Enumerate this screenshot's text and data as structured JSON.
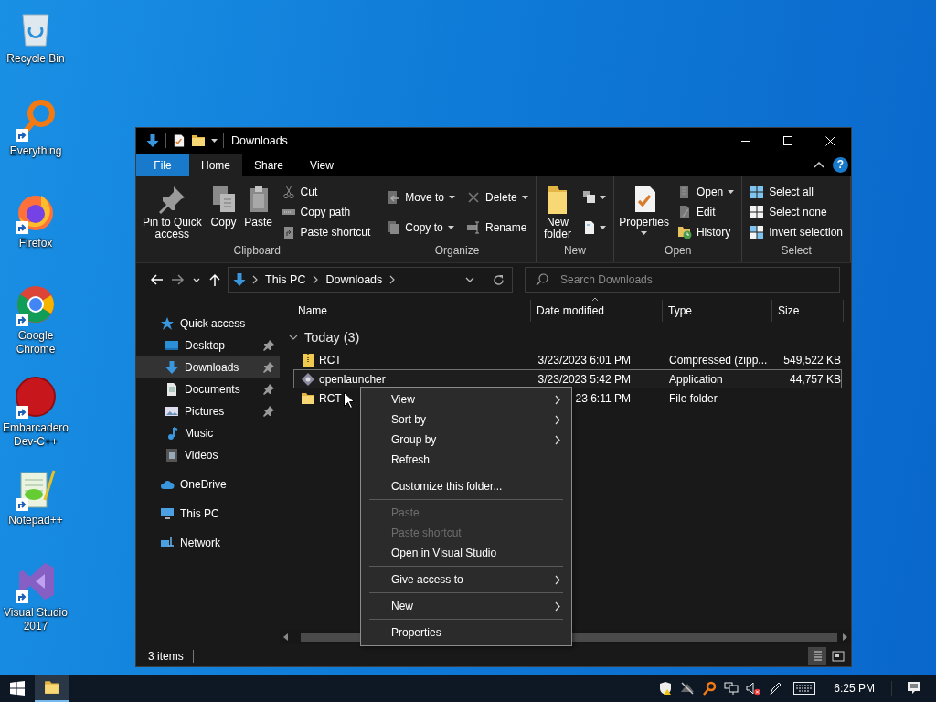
{
  "desktop_icons": [
    {
      "label": "Recycle Bin",
      "shortcut": false
    },
    {
      "label": "Everything",
      "shortcut": true
    },
    {
      "label": "Firefox",
      "shortcut": true
    },
    {
      "label": "Google Chrome",
      "shortcut": true
    },
    {
      "label": "Embarcadero Dev-C++",
      "shortcut": true
    },
    {
      "label": "Notepad++",
      "shortcut": true
    },
    {
      "label": "Visual Studio 2017",
      "shortcut": true
    }
  ],
  "window": {
    "title": "Downloads",
    "tabs": [
      {
        "label": "File",
        "kind": "file",
        "selected": false
      },
      {
        "label": "Home",
        "kind": "tab",
        "selected": true
      },
      {
        "label": "Share",
        "kind": "tab",
        "selected": false
      },
      {
        "label": "View",
        "kind": "tab",
        "selected": false
      }
    ],
    "help": "?",
    "ribbon": [
      {
        "label": "Clipboard",
        "items": [
          {
            "kind": "large",
            "label": "Pin to Quick access",
            "dropdown": false
          },
          {
            "kind": "large",
            "label": "Copy",
            "dropdown": false
          },
          {
            "kind": "large",
            "label": "Paste",
            "dropdown": false
          },
          {
            "kind": "stack",
            "items": [
              {
                "label": "Cut",
                "dropdown": false
              },
              {
                "label": "Copy path",
                "dropdown": false
              },
              {
                "label": "Paste shortcut",
                "dropdown": false
              }
            ]
          }
        ]
      },
      {
        "label": "Organize",
        "items": [
          {
            "kind": "stack",
            "items": [
              {
                "label": "Move to",
                "dropdown": true
              },
              {
                "label": "Copy to",
                "dropdown": true
              }
            ]
          },
          {
            "kind": "stack",
            "items": [
              {
                "label": "Delete",
                "dropdown": true
              },
              {
                "label": "Rename",
                "dropdown": false
              }
            ]
          }
        ]
      },
      {
        "label": "New",
        "items": [
          {
            "kind": "large",
            "label": "New folder",
            "dropdown": false
          },
          {
            "kind": "stack",
            "items": [
              {
                "dropdown": true
              },
              {
                "dropdown": true
              }
            ]
          }
        ]
      },
      {
        "label": "Open",
        "items": [
          {
            "kind": "large",
            "label": "Properties",
            "dropdown": true
          },
          {
            "kind": "stack",
            "items": [
              {
                "label": "Open",
                "dropdown": true
              },
              {
                "label": "Edit",
                "dropdown": false
              },
              {
                "label": "History",
                "dropdown": false
              }
            ]
          }
        ]
      },
      {
        "label": "Select",
        "items": [
          {
            "kind": "stack",
            "items": [
              {
                "label": "Select all",
                "dropdown": false
              },
              {
                "label": "Select none",
                "dropdown": false
              },
              {
                "label": "Invert selection",
                "dropdown": false
              }
            ]
          }
        ]
      }
    ],
    "address": {
      "path": [
        "This PC",
        "Downloads"
      ]
    },
    "search": {
      "placeholder": "Search Downloads"
    },
    "nav": [
      {
        "label": "Quick access",
        "selected": false,
        "children": [
          {
            "label": "Desktop",
            "selected": false,
            "pinned": true
          },
          {
            "label": "Downloads",
            "selected": true,
            "pinned": true
          },
          {
            "label": "Documents",
            "selected": false,
            "pinned": true
          },
          {
            "label": "Pictures",
            "selected": false,
            "pinned": true
          },
          {
            "label": "Music",
            "selected": false,
            "pinned": false
          },
          {
            "label": "Videos",
            "selected": false,
            "pinned": false
          }
        ]
      },
      {
        "label": "OneDrive",
        "selected": false
      },
      {
        "label": "This PC",
        "selected": false
      },
      {
        "label": "Network",
        "selected": false
      }
    ],
    "columns": [
      {
        "label": "Name",
        "sorted": false
      },
      {
        "label": "Date modified",
        "sorted": true
      },
      {
        "label": "Type",
        "sorted": false
      },
      {
        "label": "Size",
        "sorted": false
      }
    ],
    "groups": [
      {
        "label": "Today (3)",
        "expanded": true,
        "rows": [
          {
            "kind": "zip",
            "name": "RCT",
            "date": "3/23/2023 6:01 PM",
            "type": "Compressed (zipp...",
            "size": "549,522 KB",
            "selected": false
          },
          {
            "kind": "app",
            "name": "openlauncher",
            "date": "3/23/2023 5:42 PM",
            "type": "Application",
            "size": "44,757 KB",
            "selected": true
          },
          {
            "kind": "folder",
            "name": "RCT",
            "date": "23 6:11 PM",
            "type": "File folder",
            "selected": false
          }
        ]
      }
    ],
    "status": {
      "text": "3 items",
      "views": [
        {
          "kind": "details",
          "selected": true
        },
        {
          "kind": "tiles",
          "selected": false
        }
      ]
    }
  },
  "context_menu": [
    {
      "kind": "item",
      "label": "View",
      "submenu": true,
      "disabled": false
    },
    {
      "kind": "item",
      "label": "Sort by",
      "submenu": true,
      "disabled": false
    },
    {
      "kind": "item",
      "label": "Group by",
      "submenu": true,
      "disabled": false
    },
    {
      "kind": "item",
      "label": "Refresh",
      "submenu": false,
      "disabled": false
    },
    {
      "kind": "separator"
    },
    {
      "kind": "item",
      "label": "Customize this folder...",
      "submenu": false,
      "disabled": false
    },
    {
      "kind": "separator"
    },
    {
      "kind": "item",
      "label": "Paste",
      "submenu": false,
      "disabled": true
    },
    {
      "kind": "item",
      "label": "Paste shortcut",
      "submenu": false,
      "disabled": true
    },
    {
      "kind": "item",
      "label": "Open in Visual Studio",
      "submenu": false,
      "disabled": false
    },
    {
      "kind": "separator"
    },
    {
      "kind": "item",
      "label": "Give access to",
      "submenu": true,
      "disabled": false
    },
    {
      "kind": "separator"
    },
    {
      "kind": "item",
      "label": "New",
      "submenu": true,
      "disabled": false
    },
    {
      "kind": "separator"
    },
    {
      "kind": "item",
      "label": "Properties",
      "submenu": false,
      "disabled": false
    }
  ],
  "taskbar": {
    "apps": [
      {
        "kind": "explorer",
        "active": true
      }
    ],
    "time": "6:25 PM"
  }
}
